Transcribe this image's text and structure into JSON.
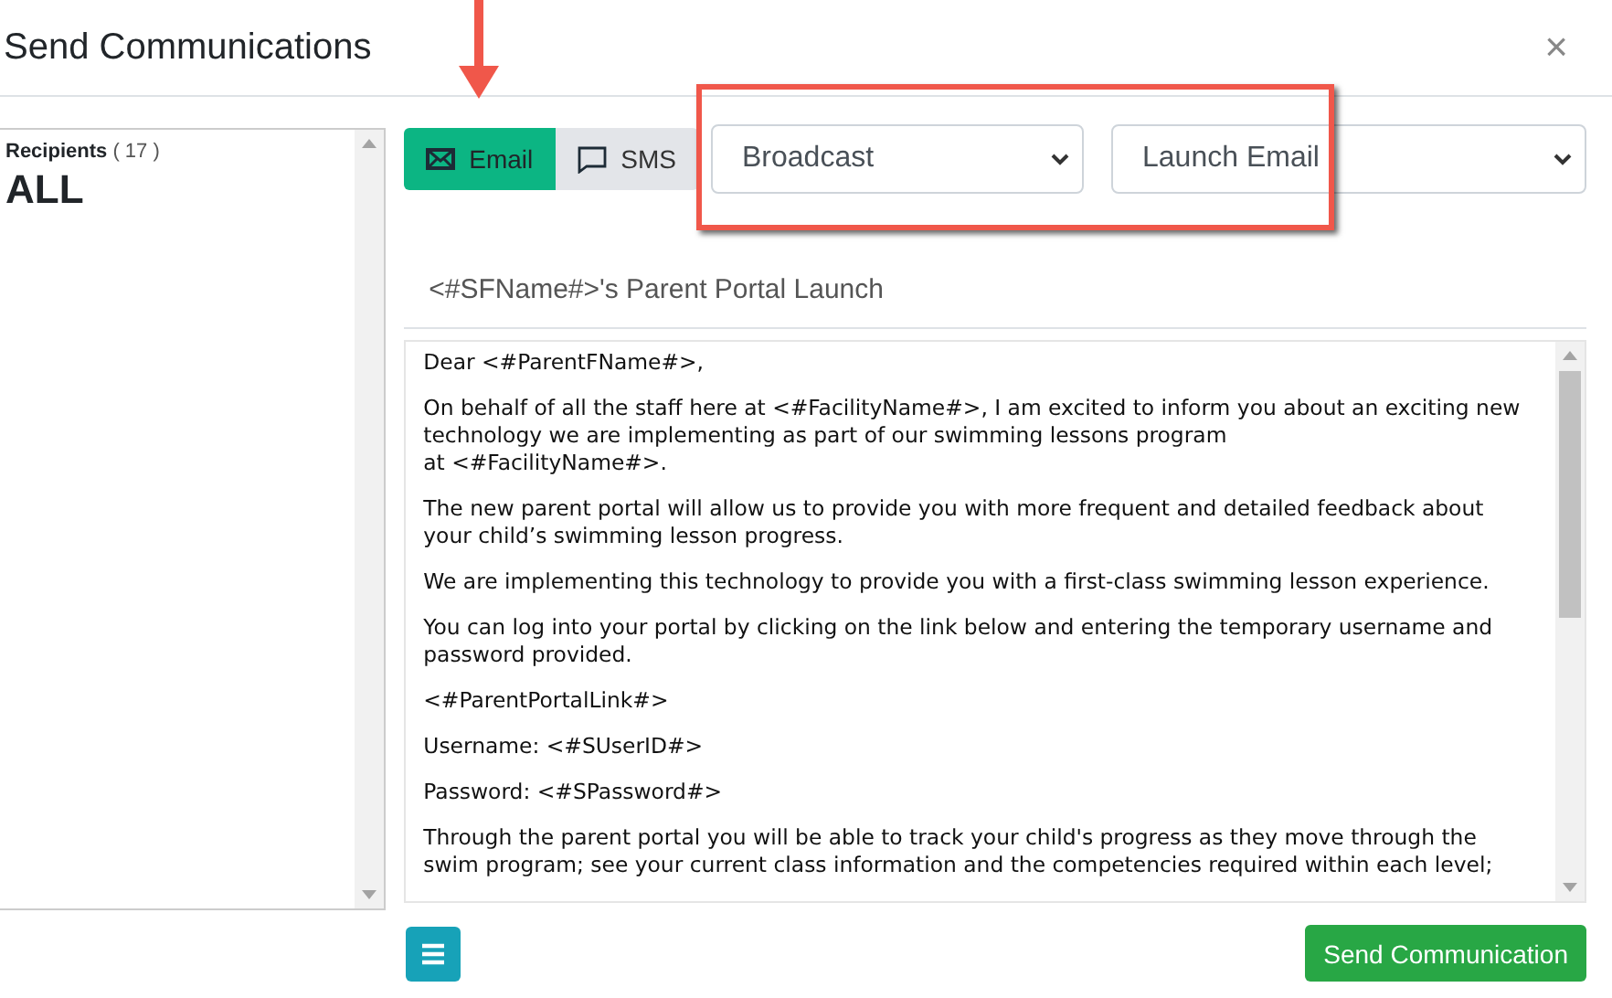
{
  "dialog": {
    "title": "Send Communications",
    "close": "×"
  },
  "recipients": {
    "label": "Recipients",
    "count": "( 17 )",
    "value": "ALL"
  },
  "tabs": [
    {
      "kind": "email",
      "label": "Email",
      "selected": true
    },
    {
      "kind": "sms",
      "label": "SMS",
      "selected": false
    }
  ],
  "selects": [
    {
      "value": "Broadcast"
    },
    {
      "value": "Launch Email"
    }
  ],
  "subject": "<#SFName#>'s Parent Portal Launch",
  "body": [
    "Dear <#ParentFName#>,",
    "On behalf of all the staff here at <#FacilityName#>, I am excited to inform you about an exciting new technology we are implementing as part of our swimming lessons program\nat <#FacilityName#>.",
    "The new parent portal will allow us to provide you with more frequent and detailed feedback about your child’s swimming lesson progress.",
    "We are implementing this technology to provide you with a first-class swimming lesson experience.",
    "You can log into your portal by clicking on the link below and entering the temporary username and password provided.",
    "<#ParentPortalLink#>",
    "Username: <#SUserID#>",
    "Password: <#SPassword#>",
    "Through the parent portal you will be able to track your child's progress as they move through the swim program; see your current class information and the competencies required within each level;"
  ],
  "send_button": "Send Communication"
}
